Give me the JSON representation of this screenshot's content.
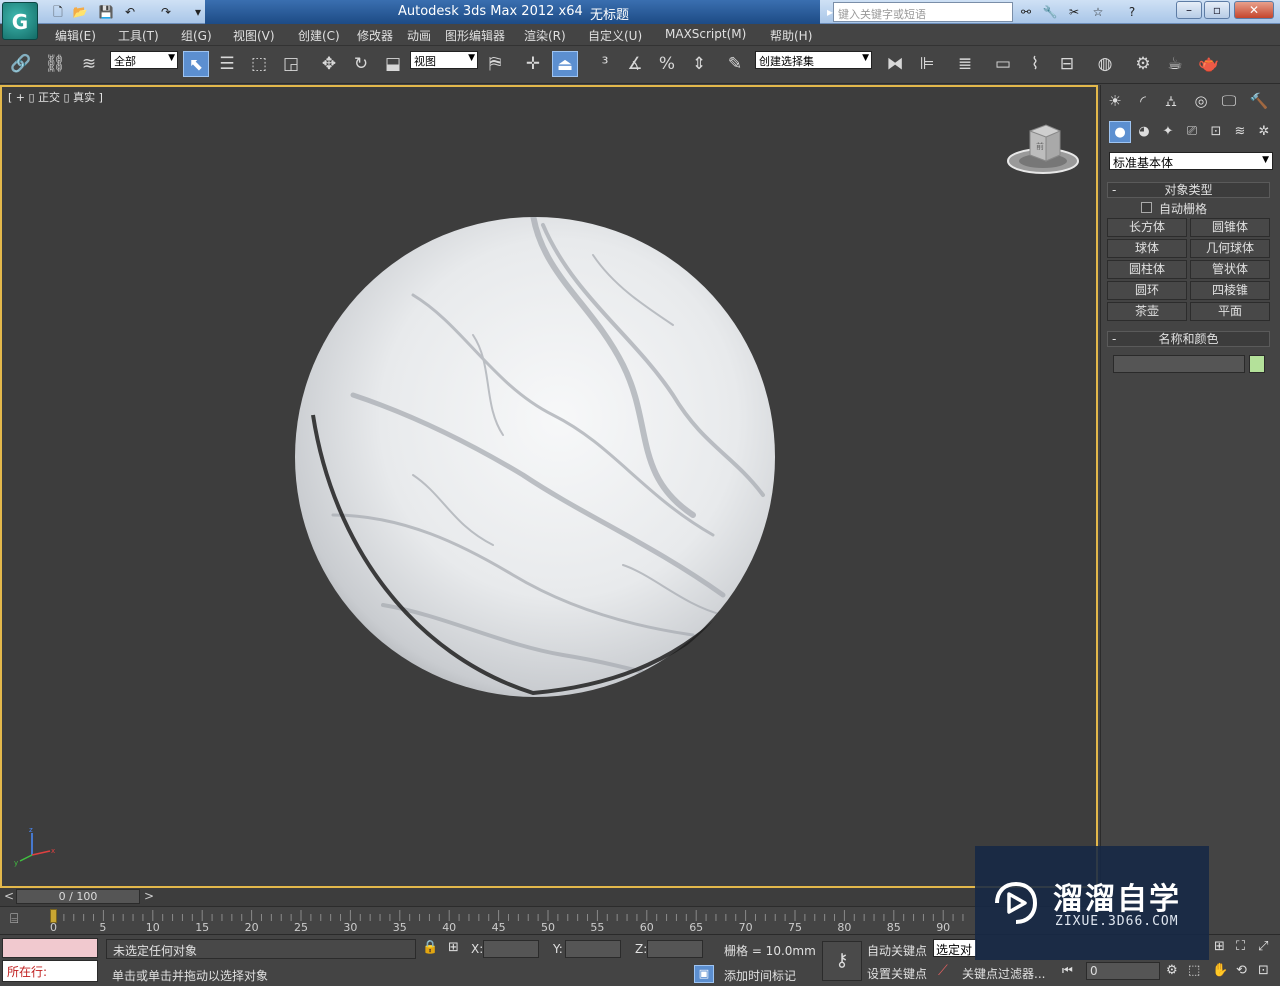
{
  "titlebar": {
    "app_title": "Autodesk 3ds Max  2012 x64",
    "document": "无标题",
    "search_placeholder": "键入关键字或短语"
  },
  "menu": [
    "编辑(E)",
    "工具(T)",
    "组(G)",
    "视图(V)",
    "创建(C)",
    "修改器",
    "动画",
    "图形编辑器",
    "渲染(R)",
    "自定义(U)",
    "MAXScript(M)",
    "帮助(H)"
  ],
  "toolbar": {
    "filter_select": "全部",
    "coord_select": "视图",
    "named_selection": "创建选择集"
  },
  "viewport": {
    "label": "[ + ▯ 正交 ▯ 真实 ]",
    "viewcube_face": "前",
    "sphere_material": "marble"
  },
  "command_panel": {
    "category": "标准基本体",
    "object_type_title": "对象类型",
    "autogrid_label": "自动栅格",
    "autogrid_checked": false,
    "objects": [
      "长方体",
      "圆锥体",
      "球体",
      "几何球体",
      "圆柱体",
      "管状体",
      "圆环",
      "四棱锥",
      "茶壶",
      "平面"
    ],
    "name_color_title": "名称和颜色",
    "object_color": "#b4e19a"
  },
  "timeline": {
    "frame_display": "0 / 100",
    "ticks": [
      "0",
      "5",
      "10",
      "15",
      "20",
      "25",
      "30",
      "35",
      "40",
      "45",
      "50",
      "55",
      "60",
      "65",
      "70",
      "75",
      "80",
      "85",
      "90"
    ]
  },
  "statusbar": {
    "listener_text": "所在行:",
    "selection_status": "未选定任何对象",
    "prompt": "单击或单击并拖动以选择对象",
    "x_label": "X:",
    "y_label": "Y:",
    "z_label": "Z:",
    "grid": "栅格 = 10.0mm",
    "add_time_tag": "添加时间标记",
    "auto_key": "自动关键点",
    "set_key": "设置关键点",
    "selected_dropdown": "选定对",
    "key_filters": "关键点过滤器...",
    "current_frame": "0"
  },
  "watermark": {
    "title": "溜溜自学",
    "url": "ZIXUE.3D66.COM"
  }
}
